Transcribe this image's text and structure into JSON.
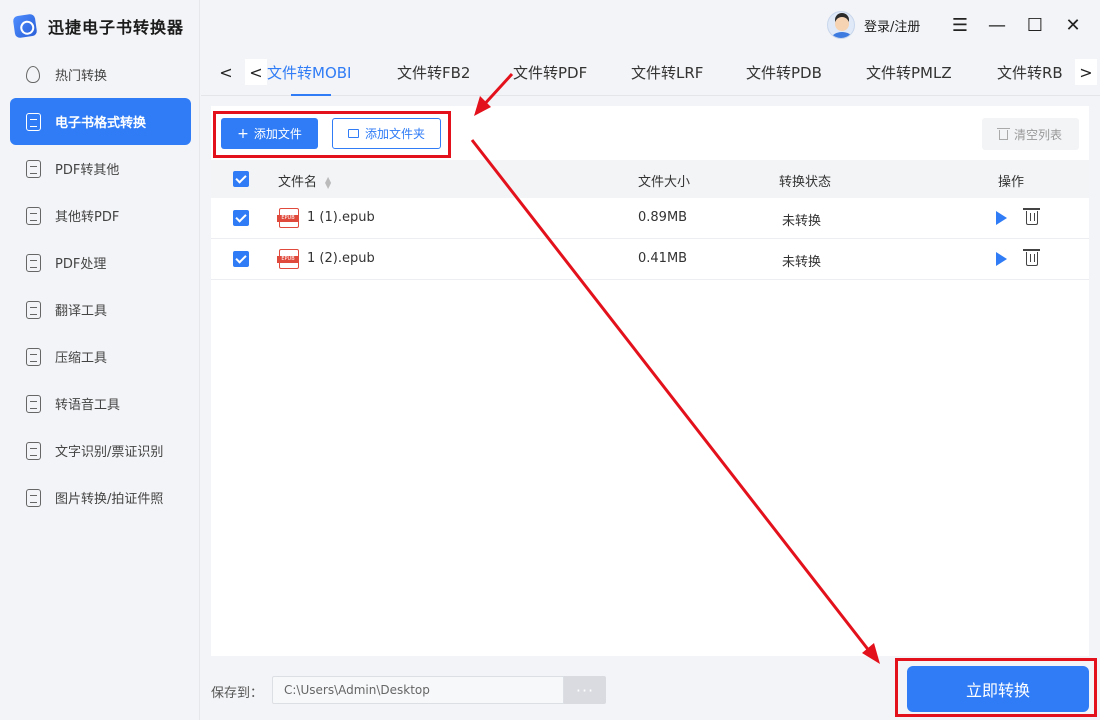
{
  "app": {
    "title": "迅捷电子书转换器"
  },
  "sidebar": {
    "items": [
      {
        "label": "热门转换",
        "icon": "flame-icon",
        "active": false
      },
      {
        "label": "电子书格式转换",
        "icon": "ebook-convert-icon",
        "active": true
      },
      {
        "label": "PDF转其他",
        "icon": "pdf-export-icon",
        "active": false
      },
      {
        "label": "其他转PDF",
        "icon": "pdf-import-icon",
        "active": false
      },
      {
        "label": "PDF处理",
        "icon": "pdf-edit-icon",
        "active": false
      },
      {
        "label": "翻译工具",
        "icon": "translate-icon",
        "active": false
      },
      {
        "label": "压缩工具",
        "icon": "compress-icon",
        "active": false
      },
      {
        "label": "转语音工具",
        "icon": "audio-icon",
        "active": false
      },
      {
        "label": "文字识别/票证识别",
        "icon": "ocr-icon",
        "active": false
      },
      {
        "label": "图片转换/拍证件照",
        "icon": "image-icon",
        "active": false
      }
    ]
  },
  "header": {
    "login_label": "登录/注册"
  },
  "tabs": [
    {
      "label": "文件转MOBI",
      "active": true
    },
    {
      "label": "文件转FB2",
      "active": false
    },
    {
      "label": "文件转PDF",
      "active": false
    },
    {
      "label": "文件转LRF",
      "active": false
    },
    {
      "label": "文件转PDB",
      "active": false
    },
    {
      "label": "文件转PMLZ",
      "active": false
    },
    {
      "label": "文件转RB",
      "active": false
    }
  ],
  "toolbar": {
    "add_file_label": "添加文件",
    "add_folder_label": "添加文件夹",
    "clear_list_label": "清空列表"
  },
  "table": {
    "headers": {
      "name": "文件名",
      "size": "文件大小",
      "status": "转换状态",
      "action": "操作"
    },
    "rows": [
      {
        "name": "1 (1).epub",
        "size": "0.89MB",
        "status": "未转换",
        "checked": true
      },
      {
        "name": "1 (2).epub",
        "size": "0.41MB",
        "status": "未转换",
        "checked": true
      }
    ]
  },
  "footer": {
    "save_label": "保存到：",
    "save_path": "C:\\Users\\Admin\\Desktop",
    "browse_label": "···",
    "convert_label": "立即转换"
  },
  "colors": {
    "accent": "#2f7cf6",
    "annotation": "#e3111b"
  }
}
